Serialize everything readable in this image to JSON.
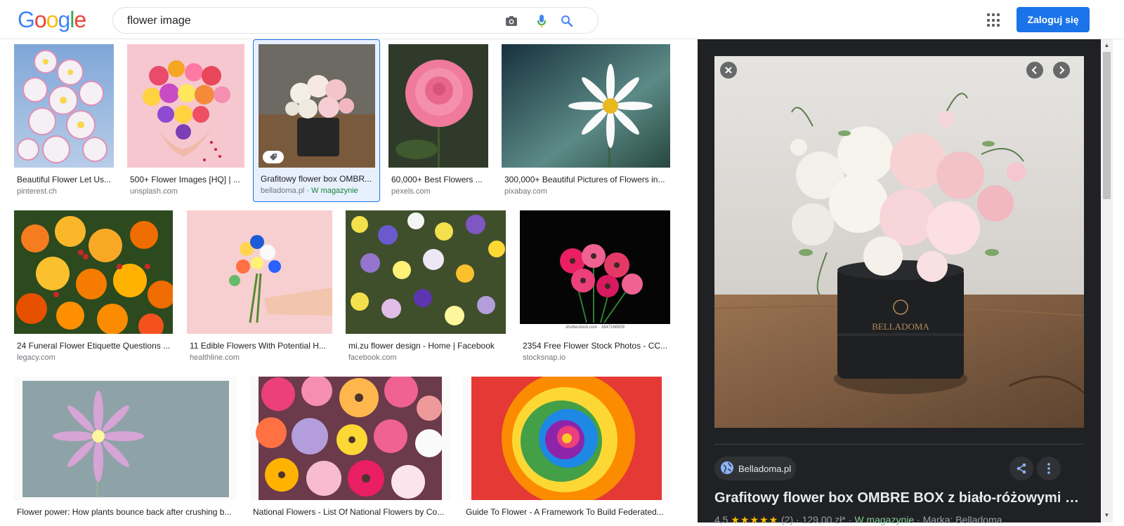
{
  "header": {
    "logo_letters": [
      {
        "ch": "G",
        "color": "#4285f4"
      },
      {
        "ch": "o",
        "color": "#ea4335"
      },
      {
        "ch": "o",
        "color": "#fbbc05"
      },
      {
        "ch": "g",
        "color": "#4285f4"
      },
      {
        "ch": "l",
        "color": "#34a853"
      },
      {
        "ch": "e",
        "color": "#ea4335"
      }
    ],
    "search_value": "flower image",
    "camera_icon": "camera-icon",
    "mic_icon": "microphone-icon",
    "search_icon": "search-icon",
    "apps_icon": "apps-grid-icon",
    "login_label": "Zaloguj się"
  },
  "results": [
    {
      "caption": "Beautiful Flower Let Us...",
      "source": "pinterest.ch"
    },
    {
      "caption": "500+ Flower Images [HQ] | ...",
      "source": "unsplash.com"
    },
    {
      "caption": "Grafitowy flower box OMBR...",
      "source": "belladoma.pl",
      "extra": " · W magazynie",
      "selected": true
    },
    {
      "caption": "60,000+ Best Flowers ...",
      "source": "pexels.com"
    },
    {
      "caption": "300,000+ Beautiful Pictures of Flowers in...",
      "source": "pixabay.com"
    },
    {
      "caption": "24 Funeral Flower Etiquette Questions ...",
      "source": "legacy.com"
    },
    {
      "caption": "11 Edible Flowers With Potential H...",
      "source": "healthline.com"
    },
    {
      "caption": "mi.zu flower design - Home | Facebook",
      "source": "facebook.com"
    },
    {
      "caption": "2354 Free Flower Stock Photos - CC...",
      "source": "stocksnap.io",
      "watermark": "shutterstock.com · 1647166909"
    },
    {
      "caption": "Flower power: How plants bounce back after crushing b...",
      "source": ""
    },
    {
      "caption": "National Flowers - List Of National Flowers by Co...",
      "source": ""
    },
    {
      "caption": "Guide To Flower - A Framework To Build Federated...",
      "source": ""
    }
  ],
  "panel": {
    "close_icon": "close-icon",
    "prev_icon": "chevron-left-icon",
    "next_icon": "chevron-right-icon",
    "box_brand": "BELLADOMA",
    "site_name": "Belladoma.pl",
    "share_icon": "share-icon",
    "more_icon": "more-vert-icon",
    "title": "Grafitowy flower box OMBRE BOX z biało-różowymi kwiatami",
    "rating": "4,5",
    "stars": "★★★★★",
    "reviews": "(2)",
    "price": "129,00 zł*",
    "stock": "W magazynie",
    "brand": "Marka: Belladoma"
  }
}
